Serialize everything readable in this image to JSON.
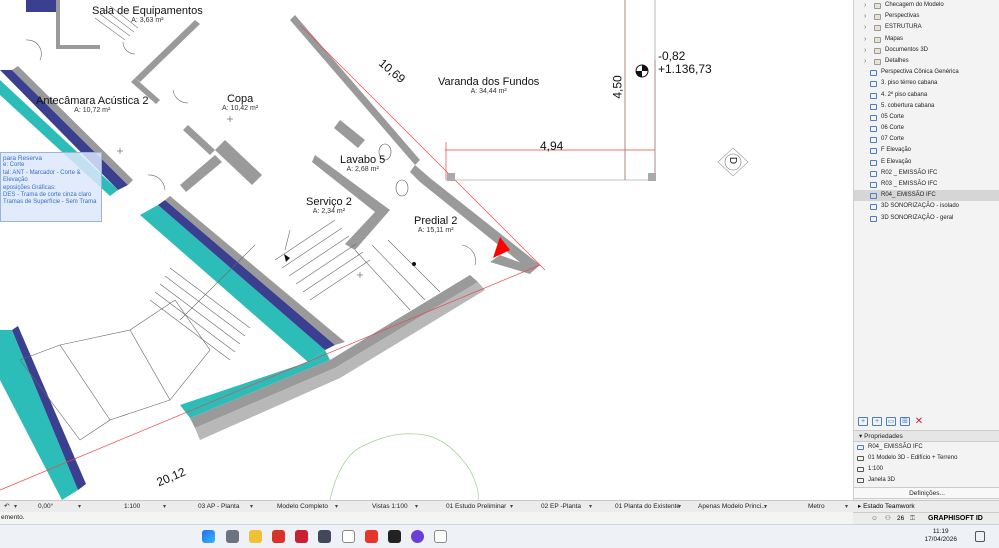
{
  "canvas": {
    "rooms": [
      {
        "name": "Sala de Equipamentos",
        "area": "A: 3,63 m²"
      },
      {
        "name": "Antecâmara Acústica 2",
        "area": "A: 10,72 m²"
      },
      {
        "name": "Copa",
        "area": "A: 10,42 m²"
      },
      {
        "name": "Varanda dos Fundos",
        "area": "A: 34,44 m²"
      },
      {
        "name": "Lavabo 5",
        "area": "A: 2,68 m²"
      },
      {
        "name": "Serviço 2",
        "area": "A: 2,34 m²"
      },
      {
        "name": "Predial 2",
        "area": "A: 15,11 m²"
      }
    ],
    "dimensions": {
      "d1069": "10,69",
      "d494": "4,94",
      "d450": "4,50",
      "d2012": "20,12",
      "level_top": "-0,82",
      "level_bottom": "+1.136,73",
      "marker": "D"
    },
    "legend_lines": [
      "para Reserva",
      "",
      "",
      "e: Corte",
      "tal: ANT - Marcador - Corte & Elevação",
      "eposições Gráficas:",
      "DES - Trama de corte cinza claro",
      "Tramas de Superfície - Sem Trama"
    ]
  },
  "navigator": {
    "items": [
      {
        "label": "Checagem do Modelo",
        "type": "folder"
      },
      {
        "label": "Perspectivas",
        "type": "folder"
      },
      {
        "label": "ESTRUTURA",
        "type": "folder"
      },
      {
        "label": "Mapas",
        "type": "folder"
      },
      {
        "label": "Documentos 3D",
        "type": "folder"
      },
      {
        "label": "Detalhes",
        "type": "folder"
      },
      {
        "label": "Perspectiva Cônica Genérica",
        "type": "view"
      },
      {
        "label": "3. piso térreo cabana",
        "type": "view"
      },
      {
        "label": "4. 2º piso cabana",
        "type": "view"
      },
      {
        "label": "5. cobertura cabana",
        "type": "view"
      },
      {
        "label": "05 Corte",
        "type": "view"
      },
      {
        "label": "06 Corte",
        "type": "view"
      },
      {
        "label": "07 Corte",
        "type": "view"
      },
      {
        "label": "F Elevação",
        "type": "view"
      },
      {
        "label": "E Elevação",
        "type": "view"
      },
      {
        "label": "R02 _ EMISSÃO IFC",
        "type": "view"
      },
      {
        "label": "R03 _ EMISSÃO IFC",
        "type": "view"
      },
      {
        "label": "R04_ EMISSÃO IFC",
        "type": "view",
        "selected": true
      },
      {
        "label": "3D SONORIZAÇÃO - isolado",
        "type": "view"
      },
      {
        "label": "3D SONORIZAÇÃO - geral",
        "type": "view"
      }
    ]
  },
  "properties": {
    "header": "Propriedades",
    "rows": [
      "R04_ EMISSÃO IFC",
      "01 Modelo 3D - Edifício + Terreno",
      "1:100",
      "Janela 3D"
    ],
    "definitions_button": "Definições...",
    "teamwork_header": "Estado Teamwork"
  },
  "statusbar": {
    "angle": "0,00°",
    "scale": "1:100",
    "layout": "03 AP - Planta",
    "model": "Modelo Completo",
    "views": "Vistas 1:100",
    "study": "01 Estudo Preliminar",
    "plan": "02 EP -Planta",
    "existing": "01 Planta do Existente",
    "model_only": "Apenas Modelo Princi...",
    "unit": "Metro",
    "message": "emento.",
    "users_count": "26",
    "brand": "GRAPHISOFT ID"
  },
  "taskbar": {
    "time": "11:19",
    "date": "17/04/2026"
  },
  "colors": {
    "wall_gray": "#9a9a9a",
    "wall_teal": "#2cbdb8",
    "wall_navy": "#3a3f8f",
    "dim_red": "#e8484a",
    "accent_blue": "#4a7fc7"
  }
}
